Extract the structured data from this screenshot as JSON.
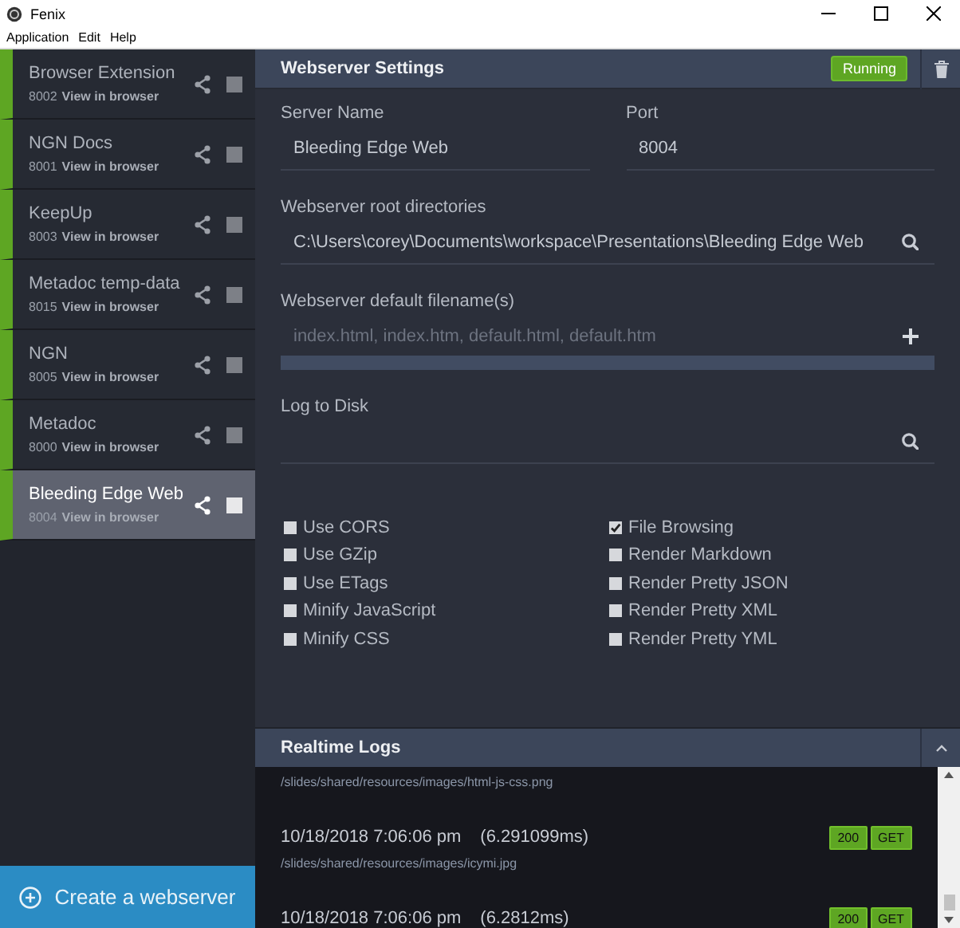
{
  "window": {
    "title": "Fenix"
  },
  "menu": [
    "Application",
    "Edit",
    "Help"
  ],
  "servers": [
    {
      "name": "Browser Extension",
      "port": "8002",
      "link": "View in browser",
      "selected": false
    },
    {
      "name": "NGN Docs",
      "port": "8001",
      "link": "View in browser",
      "selected": false
    },
    {
      "name": "KeepUp",
      "port": "8003",
      "link": "View in browser",
      "selected": false
    },
    {
      "name": "Metadoc temp-data",
      "port": "8015",
      "link": "View in browser",
      "selected": false
    },
    {
      "name": "NGN",
      "port": "8005",
      "link": "View in browser",
      "selected": false
    },
    {
      "name": "Metadoc",
      "port": "8000",
      "link": "View in browser",
      "selected": false
    },
    {
      "name": "Bleeding Edge Web",
      "port": "8004",
      "link": "View in browser",
      "selected": true
    }
  ],
  "create_button": "Create a webserver",
  "settings": {
    "title": "Webserver Settings",
    "status": "Running",
    "server_name": {
      "label": "Server Name",
      "value": "Bleeding Edge Web"
    },
    "port": {
      "label": "Port",
      "value": "8004"
    },
    "root": {
      "label": "Webserver root directories",
      "value": "C:\\Users\\corey\\Documents\\workspace\\Presentations\\Bleeding Edge Web"
    },
    "default_files": {
      "label": "Webserver default filename(s)",
      "placeholder": "index.html, index.htm, default.html, default.htm"
    },
    "log_to_disk": {
      "label": "Log to Disk"
    },
    "options_left": [
      {
        "label": "Use CORS",
        "checked": false
      },
      {
        "label": "Use GZip",
        "checked": false
      },
      {
        "label": "Use ETags",
        "checked": false
      },
      {
        "label": "Minify JavaScript",
        "checked": false
      },
      {
        "label": "Minify CSS",
        "checked": false
      }
    ],
    "options_right": [
      {
        "label": "File Browsing",
        "checked": true
      },
      {
        "label": "Render Markdown",
        "checked": false
      },
      {
        "label": "Render Pretty JSON",
        "checked": false
      },
      {
        "label": "Render Pretty XML",
        "checked": false
      },
      {
        "label": "Render Pretty YML",
        "checked": false
      }
    ]
  },
  "logs": {
    "title": "Realtime Logs",
    "leading_path": "/slides/shared/resources/images/html-js-css.png",
    "entries": [
      {
        "time": "10/18/2018 7:06:06 pm",
        "duration": "(6.291099ms)",
        "status": "200",
        "method": "GET",
        "path": "/slides/shared/resources/images/icymi.jpg"
      },
      {
        "time": "10/18/2018 7:06:06 pm",
        "duration": "(6.2812ms)",
        "status": "200",
        "method": "GET"
      }
    ]
  }
}
